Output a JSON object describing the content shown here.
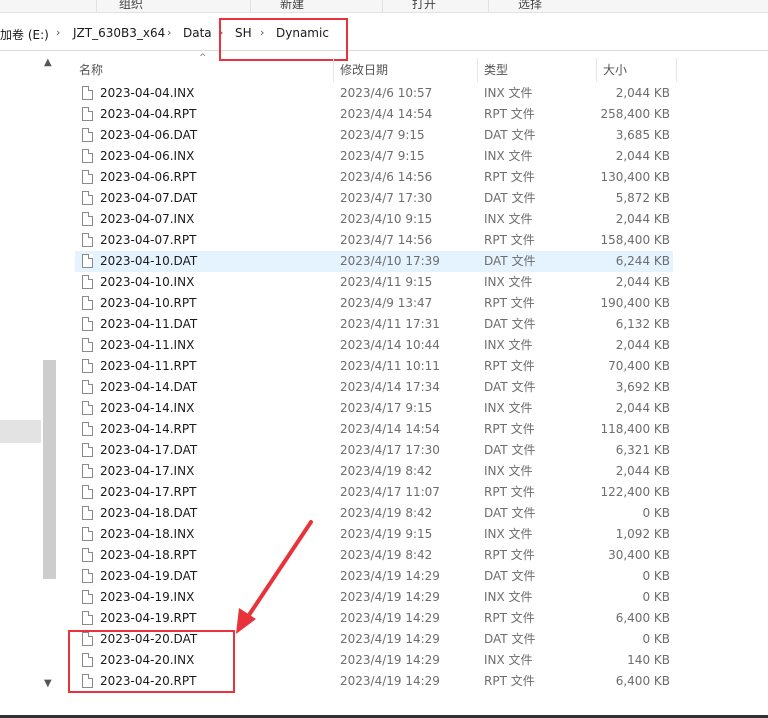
{
  "ribbon": {
    "items": [
      "组织",
      "新建",
      "打开",
      "选择"
    ]
  },
  "breadcrumb": {
    "items": [
      "加卷 (E:)",
      "JZT_630B3_x64",
      "Data",
      "SH",
      "Dynamic"
    ],
    "separator": "›"
  },
  "columns": {
    "name": "名称",
    "date": "修改日期",
    "type": "类型",
    "size": "大小"
  },
  "files": [
    {
      "name": "2023-04-04.INX",
      "date": "2023/4/6 10:57",
      "type": "INX 文件",
      "size": "2,044 KB"
    },
    {
      "name": "2023-04-04.RPT",
      "date": "2023/4/4 14:54",
      "type": "RPT 文件",
      "size": "258,400 KB"
    },
    {
      "name": "2023-04-06.DAT",
      "date": "2023/4/7 9:15",
      "type": "DAT 文件",
      "size": "3,685 KB"
    },
    {
      "name": "2023-04-06.INX",
      "date": "2023/4/7 9:15",
      "type": "INX 文件",
      "size": "2,044 KB"
    },
    {
      "name": "2023-04-06.RPT",
      "date": "2023/4/6 14:56",
      "type": "RPT 文件",
      "size": "130,400 KB"
    },
    {
      "name": "2023-04-07.DAT",
      "date": "2023/4/7 17:30",
      "type": "DAT 文件",
      "size": "5,872 KB"
    },
    {
      "name": "2023-04-07.INX",
      "date": "2023/4/10 9:15",
      "type": "INX 文件",
      "size": "2,044 KB"
    },
    {
      "name": "2023-04-07.RPT",
      "date": "2023/4/7 14:56",
      "type": "RPT 文件",
      "size": "158,400 KB"
    },
    {
      "name": "2023-04-10.DAT",
      "date": "2023/4/10 17:39",
      "type": "DAT 文件",
      "size": "6,244 KB"
    },
    {
      "name": "2023-04-10.INX",
      "date": "2023/4/11 9:15",
      "type": "INX 文件",
      "size": "2,044 KB"
    },
    {
      "name": "2023-04-10.RPT",
      "date": "2023/4/9 13:47",
      "type": "RPT 文件",
      "size": "190,400 KB"
    },
    {
      "name": "2023-04-11.DAT",
      "date": "2023/4/11 17:31",
      "type": "DAT 文件",
      "size": "6,132 KB"
    },
    {
      "name": "2023-04-11.INX",
      "date": "2023/4/14 10:44",
      "type": "INX 文件",
      "size": "2,044 KB"
    },
    {
      "name": "2023-04-11.RPT",
      "date": "2023/4/11 10:11",
      "type": "RPT 文件",
      "size": "70,400 KB"
    },
    {
      "name": "2023-04-14.DAT",
      "date": "2023/4/14 17:34",
      "type": "DAT 文件",
      "size": "3,692 KB"
    },
    {
      "name": "2023-04-14.INX",
      "date": "2023/4/17 9:15",
      "type": "INX 文件",
      "size": "2,044 KB"
    },
    {
      "name": "2023-04-14.RPT",
      "date": "2023/4/14 14:54",
      "type": "RPT 文件",
      "size": "118,400 KB"
    },
    {
      "name": "2023-04-17.DAT",
      "date": "2023/4/17 17:30",
      "type": "DAT 文件",
      "size": "6,321 KB"
    },
    {
      "name": "2023-04-17.INX",
      "date": "2023/4/19 8:42",
      "type": "INX 文件",
      "size": "2,044 KB"
    },
    {
      "name": "2023-04-17.RPT",
      "date": "2023/4/17 11:07",
      "type": "RPT 文件",
      "size": "122,400 KB"
    },
    {
      "name": "2023-04-18.DAT",
      "date": "2023/4/19 8:42",
      "type": "DAT 文件",
      "size": "0 KB"
    },
    {
      "name": "2023-04-18.INX",
      "date": "2023/4/19 9:15",
      "type": "INX 文件",
      "size": "1,092 KB"
    },
    {
      "name": "2023-04-18.RPT",
      "date": "2023/4/19 8:42",
      "type": "RPT 文件",
      "size": "30,400 KB"
    },
    {
      "name": "2023-04-19.DAT",
      "date": "2023/4/19 14:29",
      "type": "DAT 文件",
      "size": "0 KB"
    },
    {
      "name": "2023-04-19.INX",
      "date": "2023/4/19 14:29",
      "type": "INX 文件",
      "size": "0 KB"
    },
    {
      "name": "2023-04-19.RPT",
      "date": "2023/4/19 14:29",
      "type": "RPT 文件",
      "size": "6,400 KB"
    },
    {
      "name": "2023-04-20.DAT",
      "date": "2023/4/19 14:29",
      "type": "DAT 文件",
      "size": "0 KB"
    },
    {
      "name": "2023-04-20.INX",
      "date": "2023/4/19 14:29",
      "type": "INX 文件",
      "size": "140 KB"
    },
    {
      "name": "2023-04-20.RPT",
      "date": "2023/4/19 14:29",
      "type": "RPT 文件",
      "size": "6,400 KB"
    }
  ],
  "selected_file": "2023-04-10.DAT",
  "icons": {
    "scroll_up": "chevron-up-icon",
    "scroll_down": "chevron-down-icon",
    "sort": "sort-ascending-icon",
    "file": "file-icon"
  },
  "colors": {
    "annotation": "#e8323c",
    "selection": "#e5f3ff"
  }
}
